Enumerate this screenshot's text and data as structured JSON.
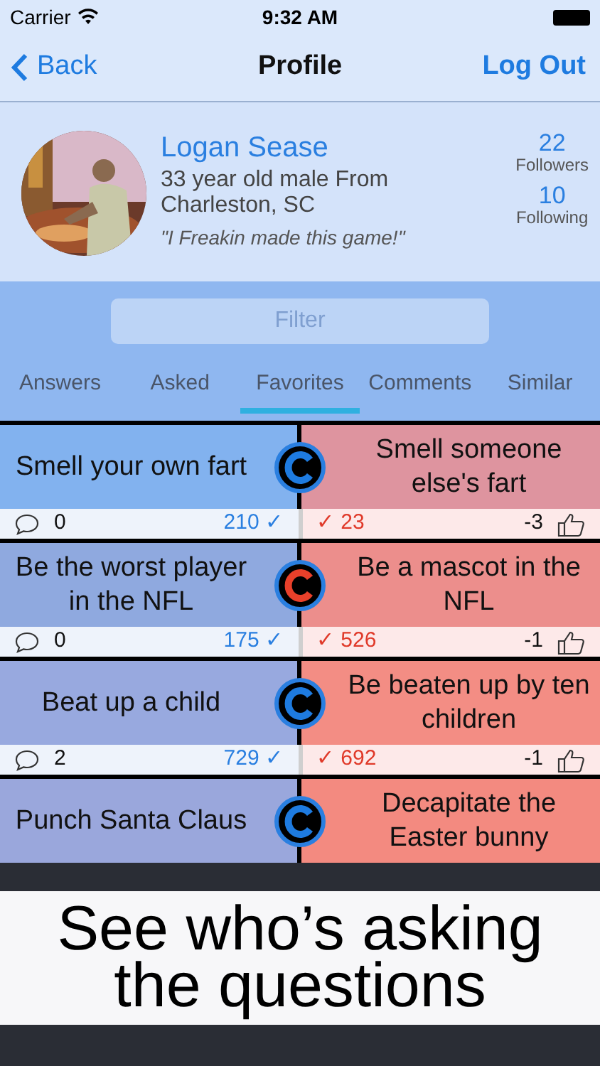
{
  "status_bar": {
    "carrier": "Carrier",
    "time": "9:32 AM"
  },
  "nav": {
    "back": "Back",
    "title": "Profile",
    "action": "Log Out"
  },
  "profile": {
    "name": "Logan Sease",
    "bio": "33 year old male From Charleston, SC",
    "quote": "\"I Freakin made this game!\"",
    "stats": [
      {
        "value": "22",
        "label": "Followers"
      },
      {
        "value": "10",
        "label": "Following"
      }
    ]
  },
  "filter": {
    "placeholder": "Filter"
  },
  "tabs": [
    {
      "label": "Answers",
      "selected": false
    },
    {
      "label": "Asked",
      "selected": false
    },
    {
      "label": "Favorites",
      "selected": true
    },
    {
      "label": "Comments",
      "selected": false
    },
    {
      "label": "Similar",
      "selected": false
    }
  ],
  "rows": [
    {
      "left": "Smell your own fart",
      "right": "Smell someone else's fart",
      "badge": {
        "color": "#1e7be0"
      },
      "comments": "0",
      "left_votes": "210 ✓",
      "right_votes": "✓ 23",
      "likes": "-3"
    },
    {
      "left": "Be the worst player in the NFL",
      "right": "Be a mascot in the NFL",
      "badge": {
        "color": "#e8402a"
      },
      "comments": "0",
      "left_votes": "175 ✓",
      "right_votes": "✓ 526",
      "likes": "-1"
    },
    {
      "left": "Beat up a child",
      "right": "Be beaten up by ten children",
      "badge": {
        "color": "#1e7be0"
      },
      "comments": "2",
      "left_votes": "729 ✓",
      "right_votes": "✓ 692",
      "likes": "-1"
    },
    {
      "left": "Punch Santa Claus",
      "right": "Decapitate the Easter bunny",
      "badge": {
        "color": "#1e7be0"
      }
    }
  ],
  "caption": "See who’s asking the questions"
}
